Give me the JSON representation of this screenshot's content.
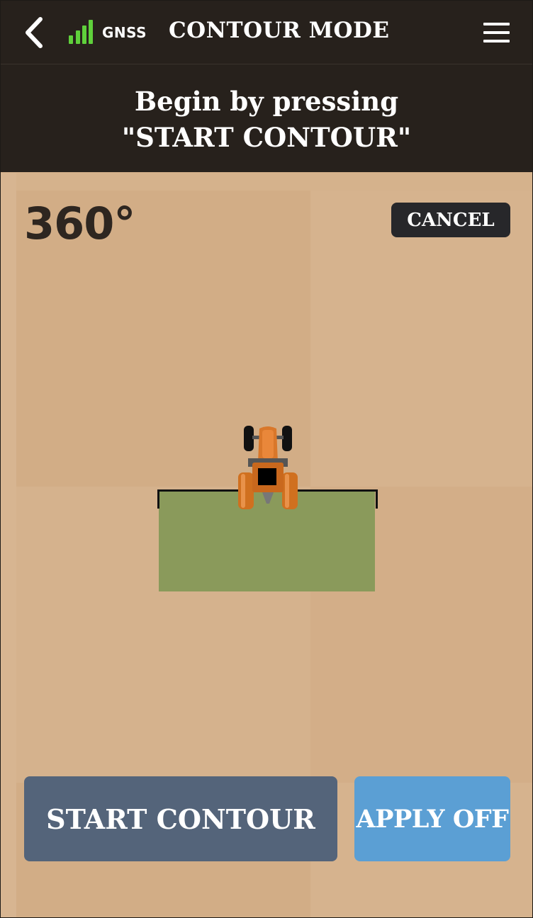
{
  "header": {
    "title": "CONTOUR MODE",
    "gnss_label": "GNSS",
    "signal_color": "#5fd03b",
    "back_icon": "chevron-left-icon",
    "menu_icon": "hamburger-menu-icon"
  },
  "banner": {
    "line1": "Begin by pressing",
    "line2": "\"START CONTOUR\""
  },
  "map": {
    "heading": "360°",
    "cancel_label": "CANCEL",
    "field_color": "#8a9a5b"
  },
  "actions": {
    "start_label": "START CONTOUR",
    "apply_label": "APPLY OFF"
  },
  "colors": {
    "bar": "#27211c",
    "ground": "#d5b28c",
    "start_button": "#54647a",
    "apply_button": "#5b9fd4"
  }
}
